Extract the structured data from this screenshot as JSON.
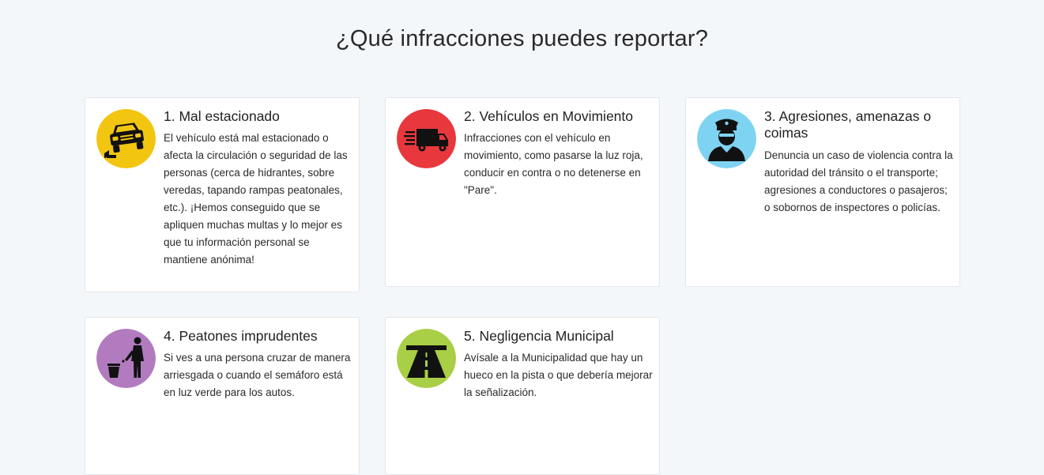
{
  "page": {
    "title": "¿Qué infracciones puedes reportar?"
  },
  "cards": [
    {
      "title": "1. Mal estacionado",
      "text": "El vehículo está mal estacionado o afecta la circulación o seguridad de las personas (cerca de hidrantes, sobre veredas, tapando rampas peatonales, etc.). ¡Hemos conseguido que se apliquen muchas multas y lo mejor es que tu información personal se mantiene anónima!",
      "icon": "parked-car-icon",
      "color": "#f2c511"
    },
    {
      "title": "2. Vehículos en Movimiento",
      "text": "Infracciones con el vehículo en movimiento, como pasarse la luz roja, conducir en contra o no detenerse en \"Pare\".",
      "icon": "moving-truck-icon",
      "color": "#e8383d"
    },
    {
      "title": "3. Agresiones, amenazas o coimas",
      "text": "Denuncia un caso de violencia contra la autoridad del tránsito o el transporte; agresiones a conductores o pasajeros; o sobornos de inspectores o policías.",
      "icon": "police-officer-icon",
      "color": "#7fd3f2"
    },
    {
      "title": "4. Peatones imprudentes",
      "text": "Si ves a una persona cruzar de manera arriesgada o cuando el semáforo está en luz verde para los autos.",
      "icon": "pedestrian-icon",
      "color": "#b27bc0"
    },
    {
      "title": "5. Negligencia Municipal",
      "text": "Avísale a la Municipalidad que hay un hueco en la pista o que debería mejorar la señalización.",
      "icon": "road-icon",
      "color": "#a8cf45"
    }
  ]
}
